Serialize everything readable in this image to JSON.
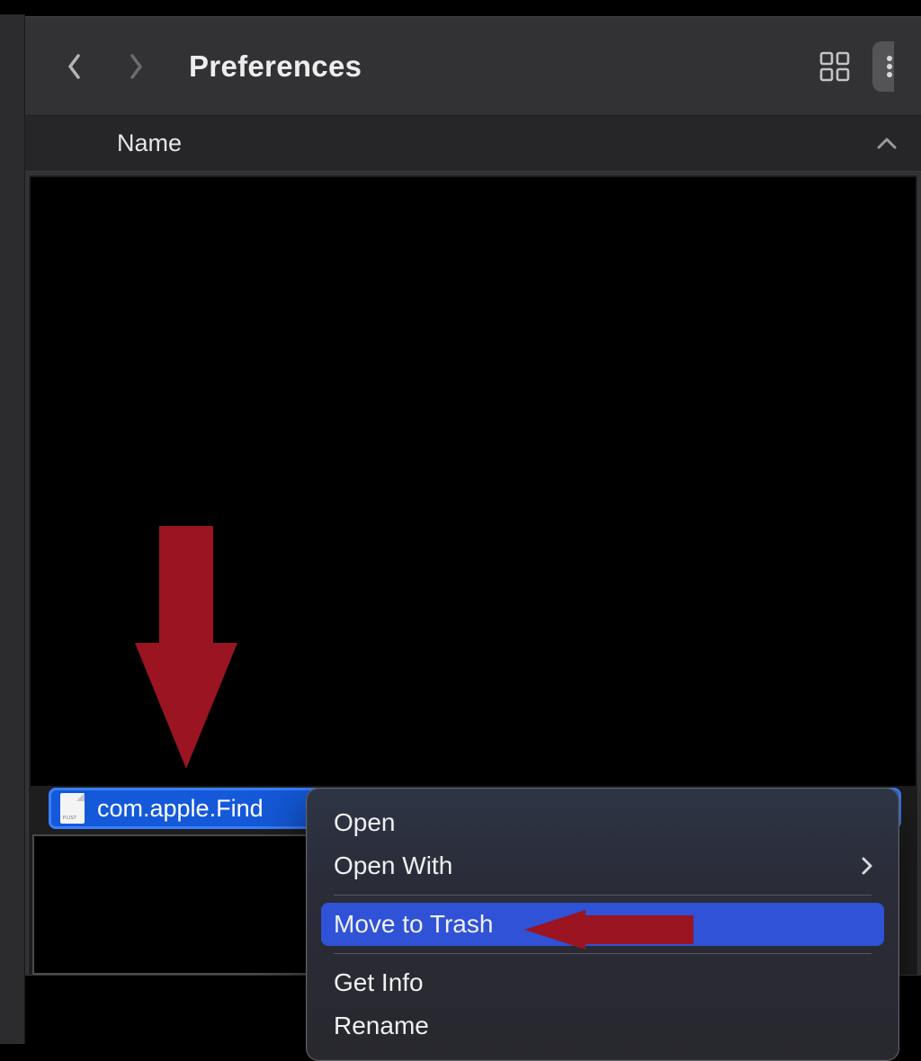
{
  "toolbar": {
    "title": "Preferences"
  },
  "columns": {
    "name": "Name"
  },
  "file": {
    "name": "com.apple.Find",
    "icon_label": "PLIST"
  },
  "context_menu": {
    "open": "Open",
    "open_with": "Open With",
    "move_to_trash": "Move to Trash",
    "get_info": "Get Info",
    "rename": "Rename"
  },
  "annotation": {
    "arrow_down_color": "#9a1421",
    "arrow_left_color": "#9a1421"
  }
}
